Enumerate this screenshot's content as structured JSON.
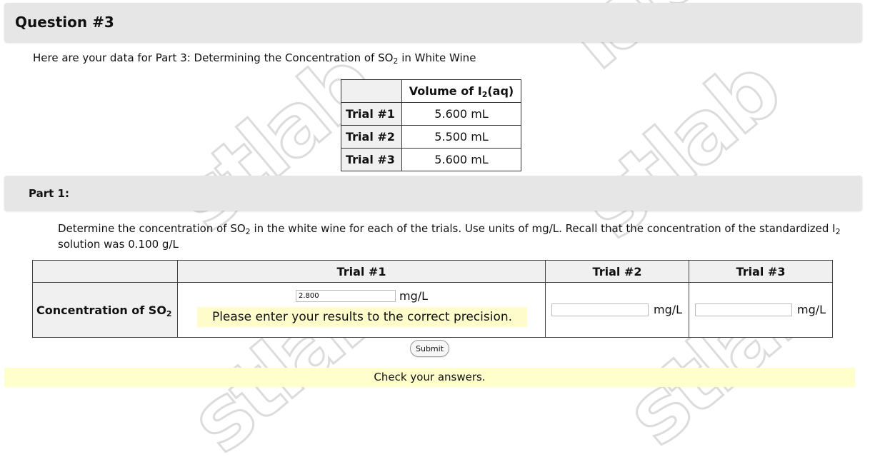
{
  "question": {
    "title": "Question #3"
  },
  "intro": {
    "prefix": "Here are your data for Part 3: Determining the Concentration of SO",
    "sub": "2",
    "suffix": " in White Wine"
  },
  "data_table": {
    "header_prefix": "Volume of I",
    "header_sub": "2",
    "header_suffix": "(aq)",
    "rows": [
      {
        "label": "Trial #1",
        "value": "5.600 mL"
      },
      {
        "label": "Trial #2",
        "value": "5.500 mL"
      },
      {
        "label": "Trial #3",
        "value": "5.600 mL"
      }
    ]
  },
  "part": {
    "title": "Part 1:"
  },
  "instructions": {
    "t1": "Determine the concentration of SO",
    "s1": "2",
    "t2": " in the white wine for each of the trials. Use units of mg/L. Recall that the concentration of the standardized I",
    "s2": "2",
    "t3": " solution was 0.100 g/L"
  },
  "answers": {
    "headers": [
      "",
      "Trial #1",
      "Trial #2",
      "Trial #3"
    ],
    "row_label_prefix": "Concentration of SO",
    "row_label_sub": "2",
    "trial1_value": "2.800",
    "trial2_value": "",
    "trial3_value": "",
    "unit": "mg/L",
    "precision_msg": "Please enter your results to the correct precision."
  },
  "submit_label": "Submit",
  "check_msg": "Check your answers.",
  "colors": {
    "header_bg": "#e6e6e6",
    "highlight": "#ffffcc"
  }
}
